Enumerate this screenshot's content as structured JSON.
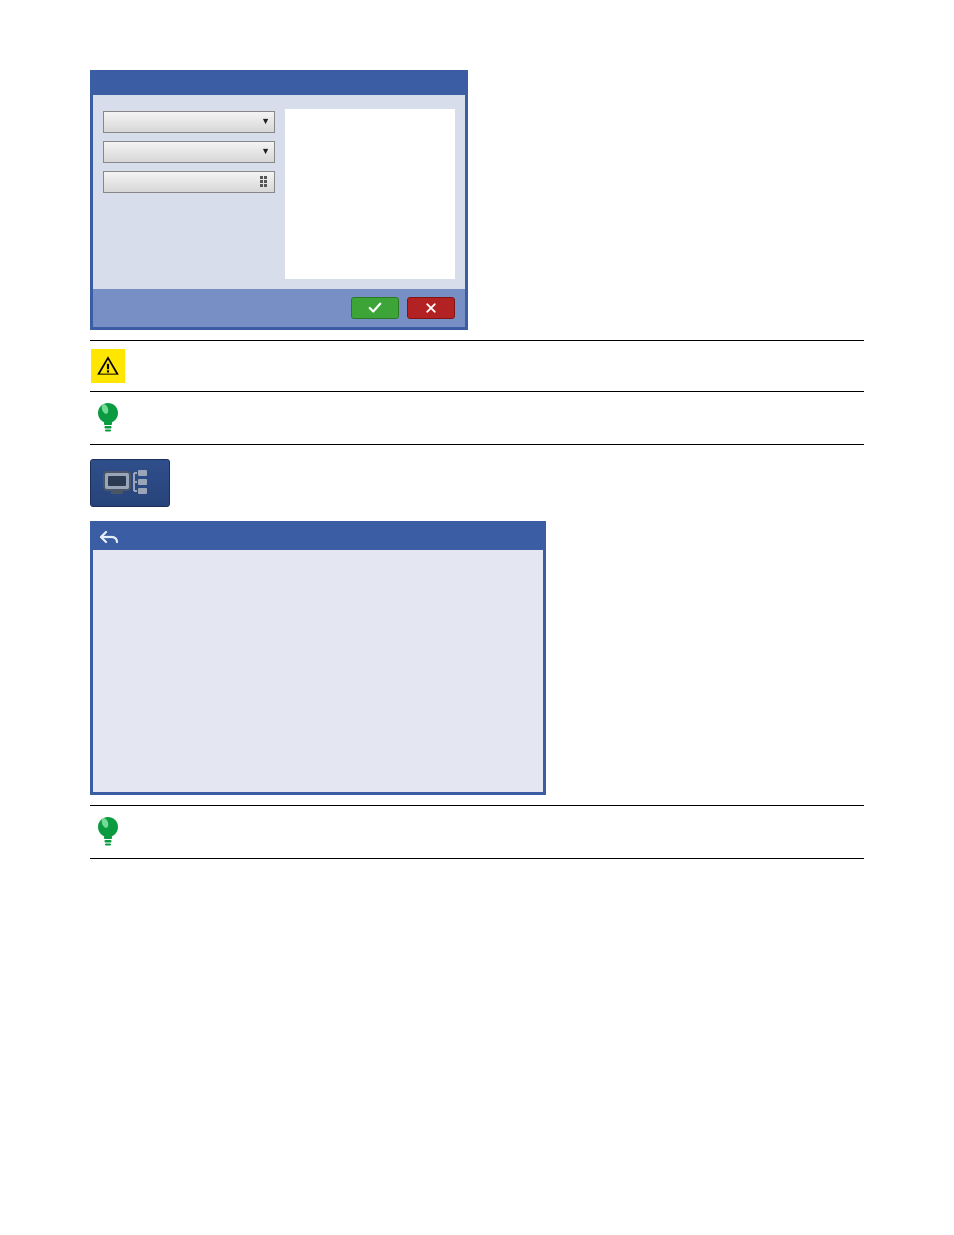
{
  "dialog1": {
    "header": "",
    "labels": {
      "hive": "",
      "host": "",
      "date": ""
    },
    "ok_label": "OK",
    "cancel_label": "Cancel"
  },
  "notes": {
    "warn": "",
    "tip1a": "",
    "tip1b": "",
    "tip2": ""
  },
  "srctree": {
    "heading": "",
    "desc1": "",
    "desc2": "",
    "panel_title": ""
  },
  "footer": ""
}
